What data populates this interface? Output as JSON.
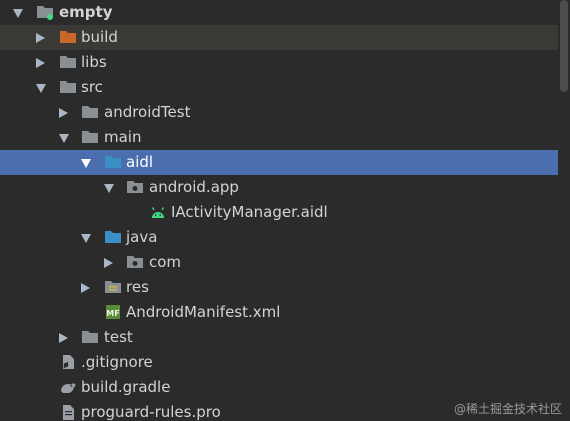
{
  "tree": {
    "root": {
      "label": "empty"
    },
    "build": {
      "label": "build"
    },
    "libs": {
      "label": "libs"
    },
    "src": {
      "label": "src"
    },
    "android_test": {
      "label": "androidTest"
    },
    "main": {
      "label": "main"
    },
    "aidl": {
      "label": "aidl"
    },
    "android_app": {
      "label": "android.app"
    },
    "iactivity_manager": {
      "label": "IActivityManager.aidl"
    },
    "java": {
      "label": "java"
    },
    "com": {
      "label": "com"
    },
    "res": {
      "label": "res"
    },
    "manifest": {
      "label": "AndroidManifest.xml"
    },
    "test": {
      "label": "test"
    },
    "gitignore": {
      "label": ".gitignore"
    },
    "build_gradle": {
      "label": "build.gradle"
    },
    "proguard": {
      "label": "proguard-rules.pro"
    }
  },
  "watermark": "@稀土掘金技术社区",
  "colors": {
    "background": "#2b2b2b",
    "selection": "#4b6eaf",
    "folder": "#8a8f94",
    "build_folder": "#c9672b",
    "source_folder": "#3a8fc7",
    "android_green": "#3ddc84"
  },
  "icons": {
    "expand": "chevron-down-icon",
    "collapse": "chevron-right-icon",
    "folder": "folder-icon",
    "package": "package-folder-icon",
    "android_file": "android-icon",
    "manifest_file": "manifest-icon",
    "gitignore_file": "gitignore-icon",
    "gradle_file": "gradle-icon",
    "text_file": "text-file-icon"
  }
}
